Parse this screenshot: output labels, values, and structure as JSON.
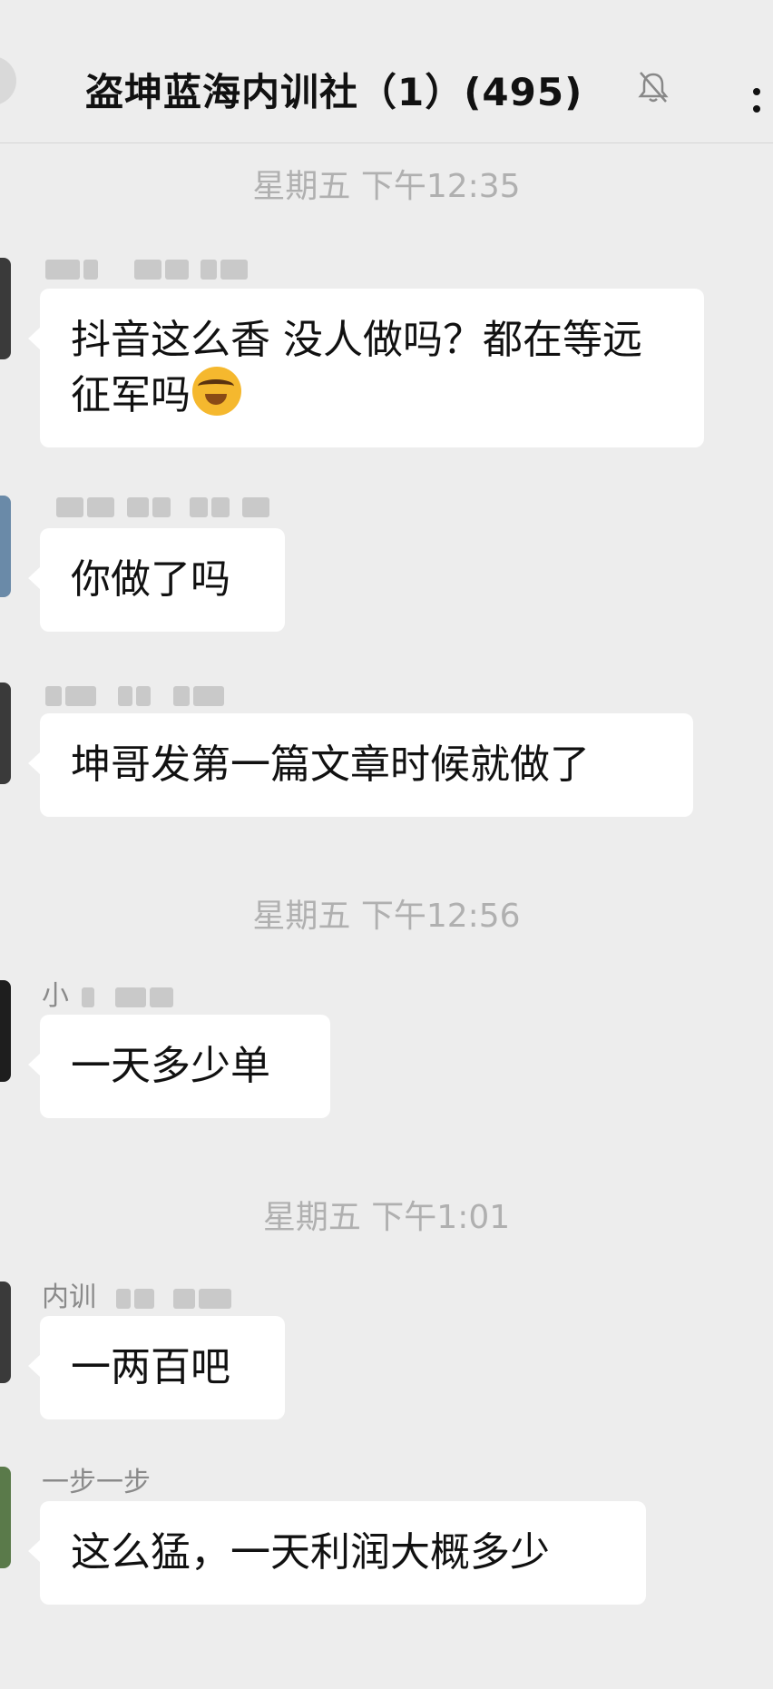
{
  "header": {
    "title": "盗坤蓝海内训社（1）(495)",
    "mute_icon": "bell-muted-icon",
    "more_icon": "more-dots-icon"
  },
  "messages": [
    {
      "type": "time",
      "text": "星期五 下午12:35"
    },
    {
      "type": "msg",
      "sender": "",
      "text": "抖音这么香 没人做吗？都在等远征军吗",
      "emoji": "face-with-tears-of-joy"
    },
    {
      "type": "msg",
      "sender": "",
      "text": "你做了吗"
    },
    {
      "type": "msg",
      "sender": "",
      "text": "坤哥发第一篇文章时候就做了"
    },
    {
      "type": "time",
      "text": "星期五 下午12:56"
    },
    {
      "type": "msg",
      "sender": "小",
      "text": "一天多少单"
    },
    {
      "type": "time",
      "text": "星期五 下午1:01"
    },
    {
      "type": "msg",
      "sender": "内训",
      "text": "一两百吧"
    },
    {
      "type": "msg",
      "sender": "一步一步",
      "text": "这么猛，一天利润大概多少"
    }
  ]
}
